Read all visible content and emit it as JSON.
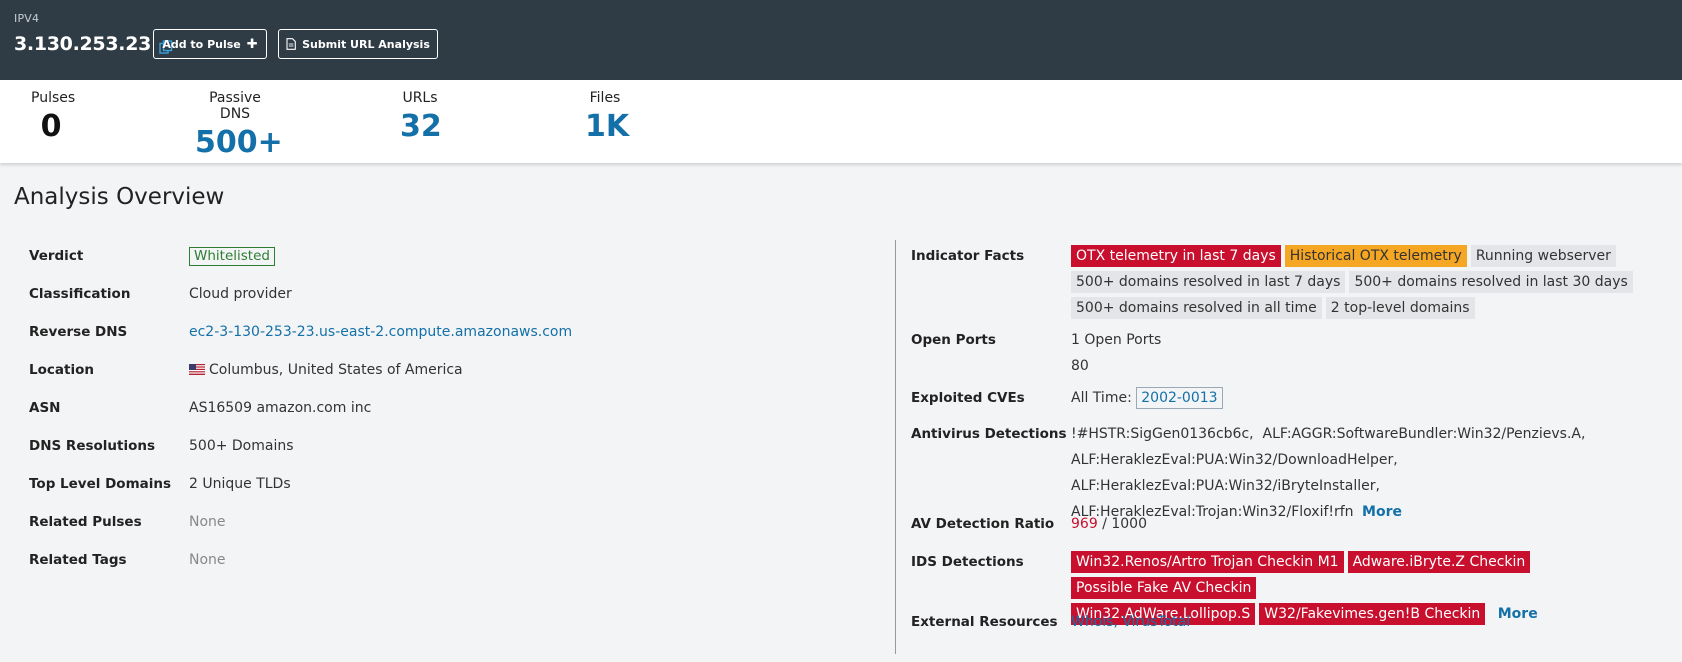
{
  "header": {
    "ip_type": "IPV4",
    "ip": "3.130.253.23",
    "add_pulse_label": "Add to Pulse",
    "submit_url_label": "Submit URL Analysis"
  },
  "stats": [
    {
      "label": "Pulses",
      "value": "0"
    },
    {
      "label": "Passive DNS",
      "value": "500+"
    },
    {
      "label": "URLs",
      "value": "32"
    },
    {
      "label": "Files",
      "value": "1K"
    }
  ],
  "section_title": "Analysis Overview",
  "left": {
    "verdict": {
      "key": "Verdict",
      "value": "Whitelisted"
    },
    "classification": {
      "key": "Classification",
      "value": "Cloud provider"
    },
    "reverse_dns": {
      "key": "Reverse DNS",
      "value": "ec2-3-130-253-23.us-east-2.compute.amazonaws.com"
    },
    "location": {
      "key": "Location",
      "value": "Columbus, United States of America"
    },
    "asn": {
      "key": "ASN",
      "value": "AS16509 amazon.com inc"
    },
    "dns_resolutions": {
      "key": "DNS Resolutions",
      "value": "500+ Domains"
    },
    "tlds": {
      "key": "Top Level Domains",
      "value": "2 Unique TLDs"
    },
    "related_pulses": {
      "key": "Related Pulses",
      "value": "None"
    },
    "related_tags": {
      "key": "Related Tags",
      "value": "None"
    }
  },
  "right": {
    "indicator_facts": {
      "key": "Indicator Facts",
      "tags": [
        "OTX telemetry in last 7 days",
        "Historical OTX telemetry",
        "Running webserver",
        "500+ domains resolved in last 7 days",
        "500+ domains resolved in last 30 days",
        "500+ domains resolved in all time",
        "2 top-level domains"
      ]
    },
    "open_ports": {
      "key": "Open Ports",
      "count": "1 Open Ports",
      "port": "80"
    },
    "cves": {
      "key": "Exploited CVEs",
      "prefix": "All Time:",
      "cve": "2002-0013"
    },
    "antivirus": {
      "key": "Antivirus Detections",
      "items": [
        "!#HSTR:SigGen0136cb6c,",
        "ALF:AGGR:SoftwareBundler:Win32/Penzievs.A,",
        "ALF:HeraklezEval:PUA:Win32/DownloadHelper,",
        "ALF:HeraklezEval:PUA:Win32/iBryteInstaller,",
        "ALF:HeraklezEval:Trojan:Win32/Floxif!rfn"
      ],
      "more": "More"
    },
    "av_ratio": {
      "key": "AV Detection Ratio",
      "detected": "969",
      "total": "/ 1000"
    },
    "ids": {
      "key": "IDS Detections",
      "tags": [
        "Win32.Renos/Artro Trojan Checkin M1",
        "Adware.iBryte.Z Checkin",
        "Possible Fake AV Checkin",
        "Win32.AdWare.Lollipop.S",
        "W32/Fakevimes.gen!B Checkin"
      ],
      "more": "More"
    },
    "external": {
      "key": "External Resources",
      "links": "Whois, VirusTotal"
    }
  },
  "colors": {
    "header_bg": "#2f3b45",
    "link_blue": "#1470a8",
    "alert_red": "#c8102e",
    "warn_orange": "#f5a623",
    "verdict_green": "#2e7d32"
  }
}
